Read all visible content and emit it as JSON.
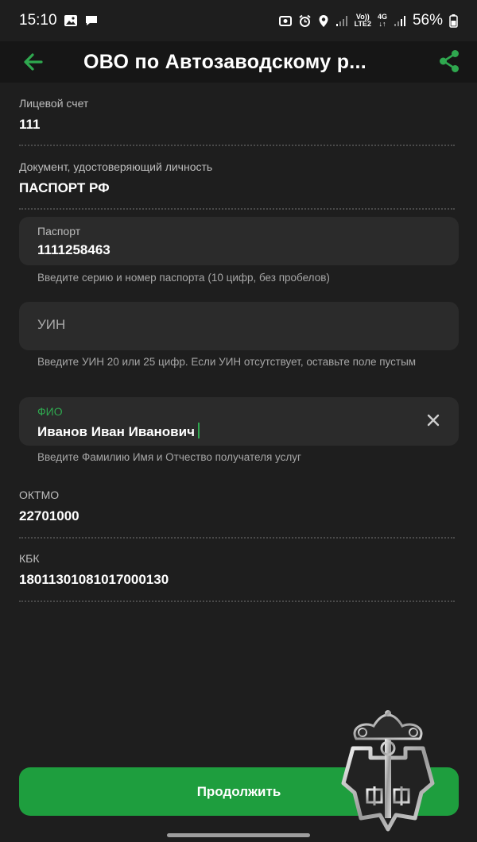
{
  "status_bar": {
    "time": "15:10",
    "network_top": "Vo))",
    "network_bottom": "LTE2",
    "net_type_top": "4G",
    "net_type_bottom": "↓↑",
    "battery": "56%"
  },
  "header": {
    "title": "ОВО по Автозаводскому р..."
  },
  "fields": {
    "account": {
      "label": "Лицевой счет",
      "value": "111"
    },
    "document": {
      "label": "Документ, удостоверяющий личность",
      "value": "ПАСПОРТ РФ"
    },
    "passport": {
      "label": "Паспорт",
      "value": "1111258463",
      "helper": "Введите серию и номер паспорта (10 цифр, без пробелов)"
    },
    "uin": {
      "placeholder": "УИН",
      "helper": "Введите УИН 20 или 25 цифр. Если УИН отсутствует, оставьте поле пустым"
    },
    "fio": {
      "label": "ФИО",
      "value": "Иванов Иван Иванович",
      "helper": "Введите Фамилию Имя и Отчество получателя услуг"
    },
    "oktmo": {
      "label": "ОКТМО",
      "value": "22701000"
    },
    "kbk": {
      "label": "КБК",
      "value": "18011301081017000130"
    }
  },
  "continue_button": {
    "label": "Продолжить"
  },
  "colors": {
    "accent": "#2fa84f",
    "button": "#1e9e3e",
    "background": "#1e1e1e",
    "app_bar": "#161616",
    "input": "#2b2b2b"
  },
  "icons": {
    "back": "arrow-left-icon",
    "share": "share-icon",
    "clear": "close-icon",
    "emblem": "emblem-icon"
  }
}
